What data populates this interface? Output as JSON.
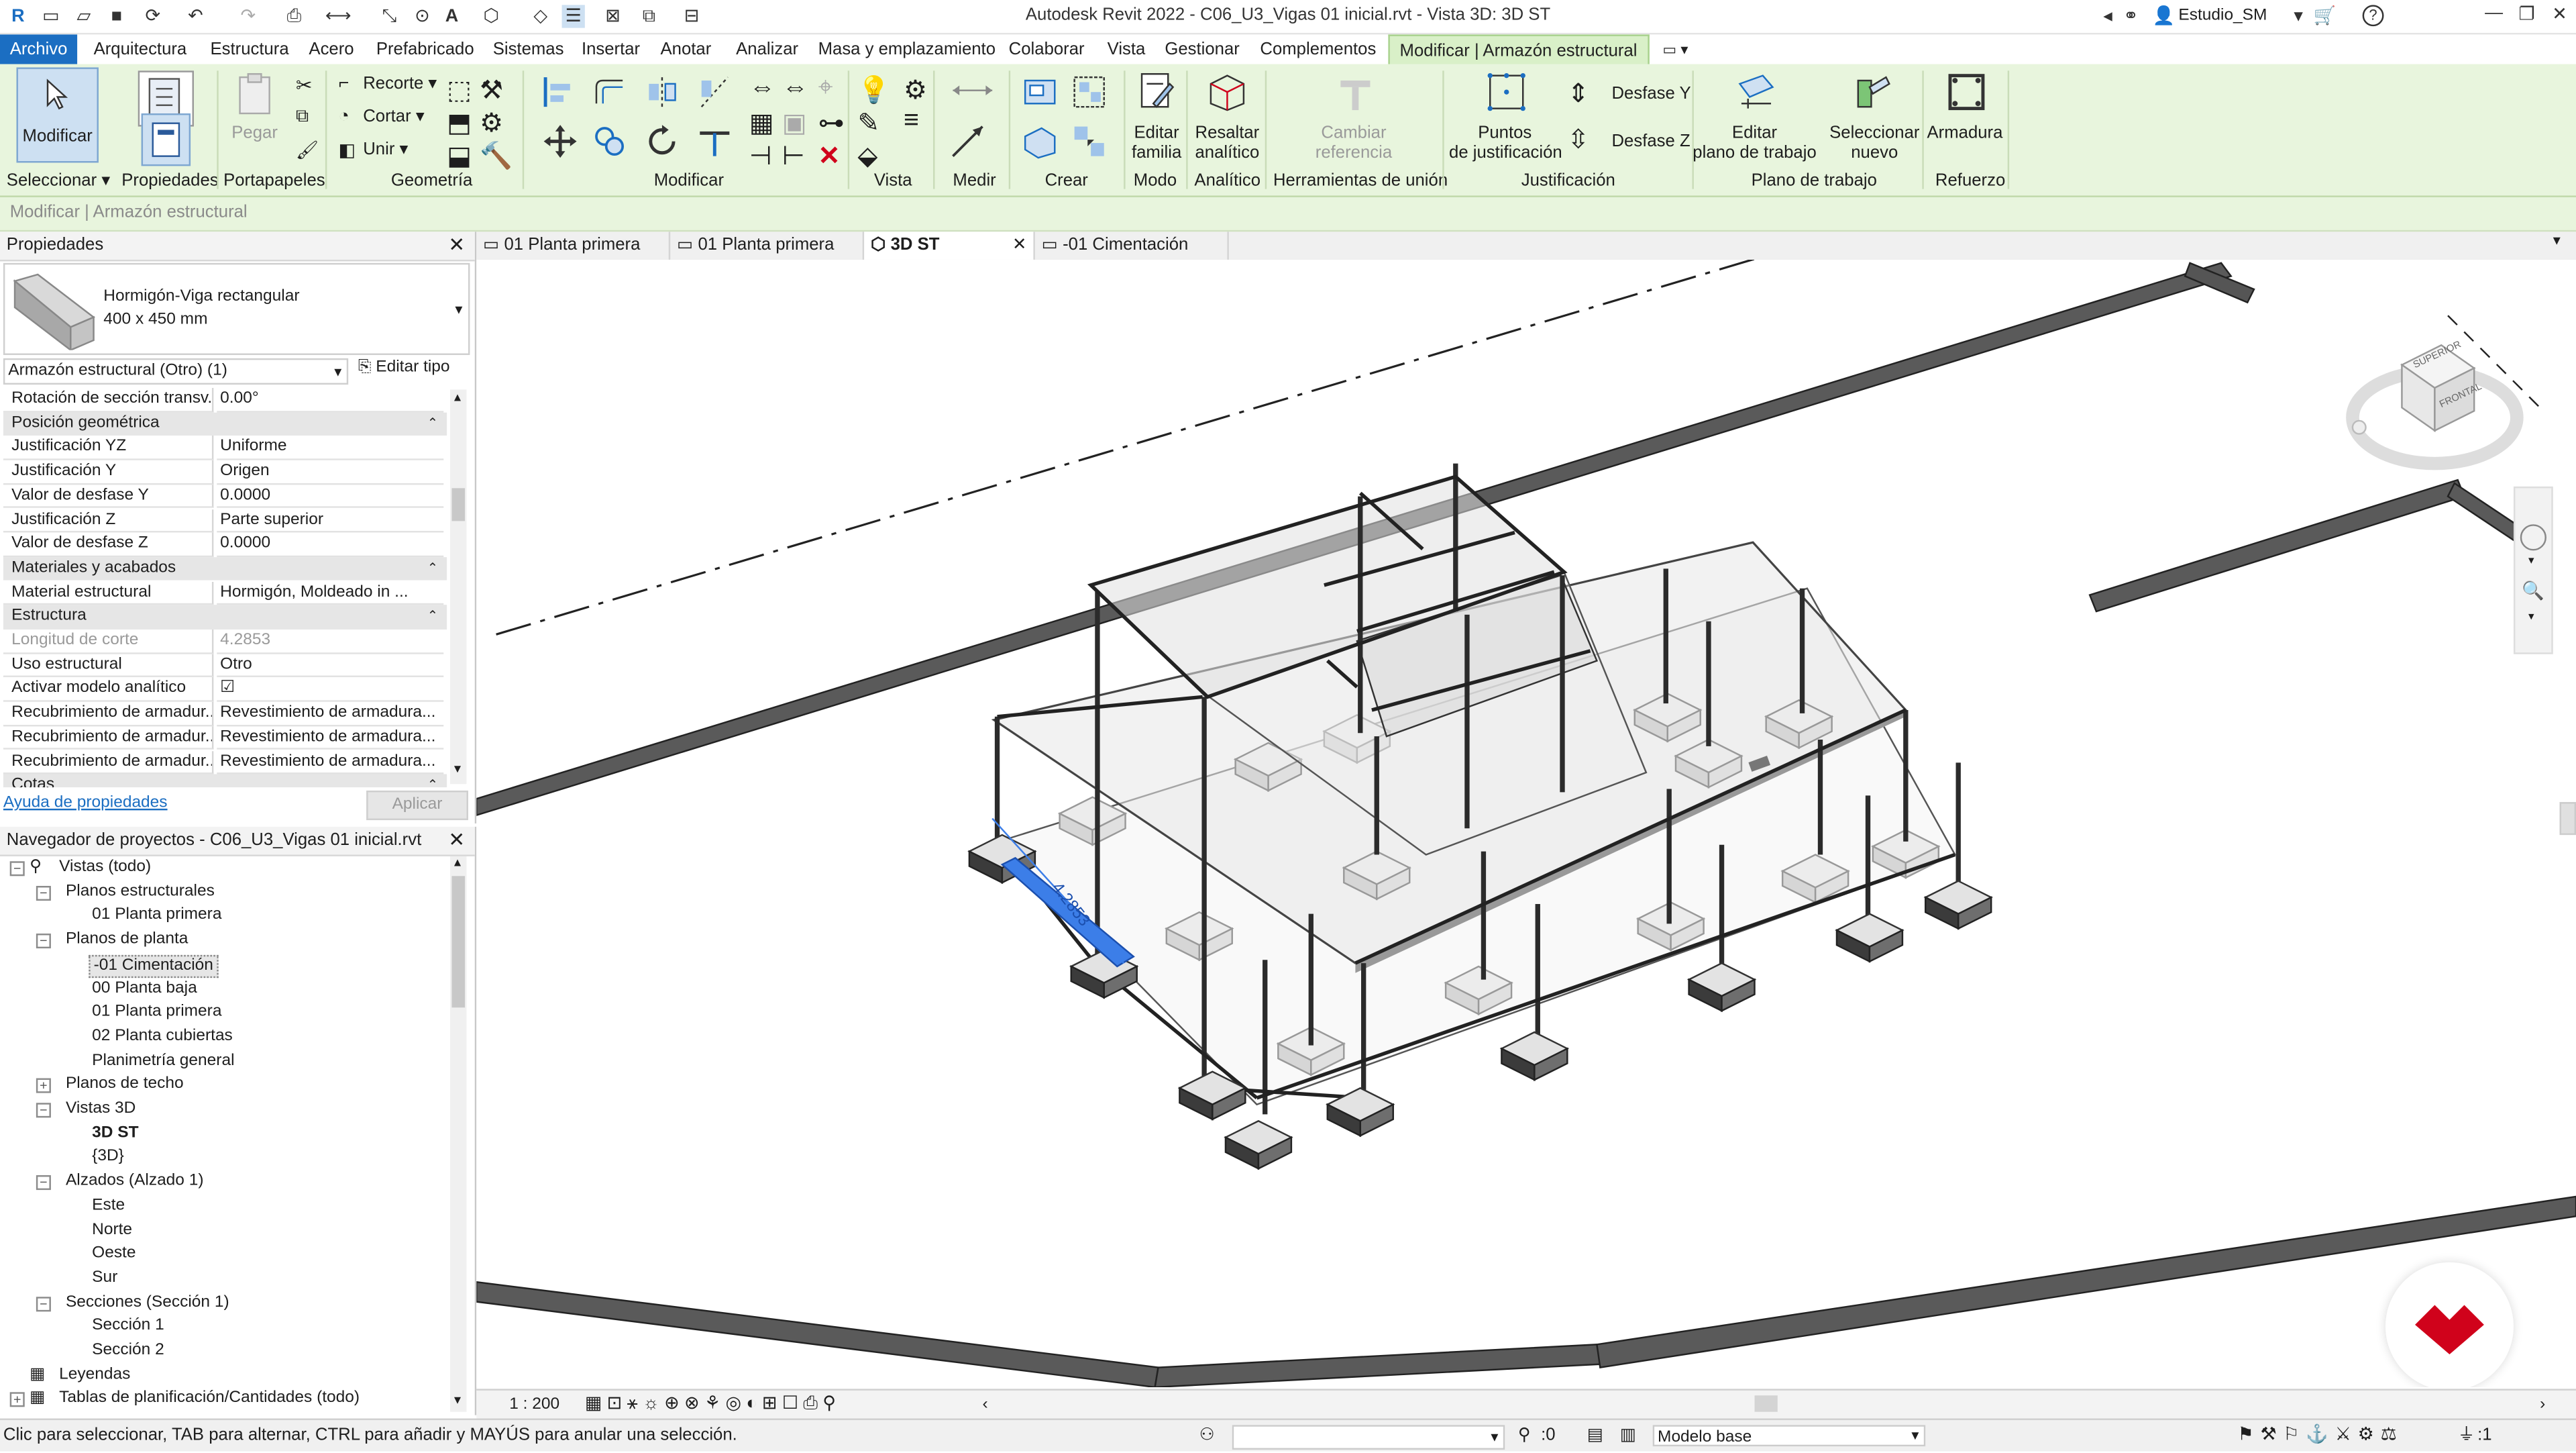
{
  "window": {
    "title": "Autodesk Revit 2022 - C06_U3_Vigas 01 inicial.rvt - Vista 3D: 3D ST",
    "user": "Estudio_SM",
    "help": "?"
  },
  "menu_tabs": [
    "Archivo",
    "Arquitectura",
    "Estructura",
    "Acero",
    "Prefabricado",
    "Sistemas",
    "Insertar",
    "Anotar",
    "Analizar",
    "Masa y emplazamiento",
    "Colaborar",
    "Vista",
    "Gestionar",
    "Complementos",
    "Modificar | Armazón estructural"
  ],
  "ribbon": {
    "modify_label": "Modificar",
    "paste_label": "Pegar",
    "recorte": "Recorte",
    "cortar": "Cortar",
    "unir": "Unir",
    "editar_familia": [
      "Editar",
      "familia"
    ],
    "resaltar_analitico": [
      "Resaltar",
      "analítico"
    ],
    "cambiar_referencia": [
      "Cambiar",
      "referencia"
    ],
    "puntos_justificacion": [
      "Puntos",
      "de justificación"
    ],
    "desfase_y": "Desfase Y",
    "desfase_z": "Desfase Z",
    "editar_plano": [
      "Editar",
      "plano de trabajo"
    ],
    "seleccionar_nuevo": [
      "Seleccionar",
      "nuevo"
    ],
    "armadura": "Armadura",
    "panels": [
      "Seleccionar",
      "Propiedades",
      "Portapapeles",
      "Geometría",
      "Modificar",
      "Vista",
      "Medir",
      "Crear",
      "Modo",
      "Analítico",
      "Herramientas de unión",
      "Justificación",
      "Plano de trabajo",
      "Refuerzo"
    ]
  },
  "options_bar": "Modificar | Armazón estructural",
  "properties": {
    "header": "Propiedades",
    "type_name": "Hormigón-Viga rectangular",
    "type_size": "400 x 450 mm",
    "filter": "Armazón estructural (Otro) (1)",
    "edit_type": "Editar tipo",
    "rows": [
      {
        "k": "Rotación de sección transv...",
        "v": "0.00°"
      },
      {
        "group": "Posición geométrica"
      },
      {
        "k": "Justificación YZ",
        "v": "Uniforme"
      },
      {
        "k": "Justificación Y",
        "v": "Origen"
      },
      {
        "k": "Valor de desfase Y",
        "v": "0.0000"
      },
      {
        "k": "Justificación Z",
        "v": "Parte superior"
      },
      {
        "k": "Valor de desfase Z",
        "v": "0.0000"
      },
      {
        "group": "Materiales y acabados"
      },
      {
        "k": "Material estructural",
        "v": "Hormigón, Moldeado in ..."
      },
      {
        "group": "Estructura"
      },
      {
        "k": "Longitud de corte",
        "v": "4.2853",
        "gray": true
      },
      {
        "k": "Uso estructural",
        "v": "Otro"
      },
      {
        "k": "Activar modelo analítico",
        "v": "☑"
      },
      {
        "k": "Recubrimiento de armadur...",
        "v": "Revestimiento de armadura..."
      },
      {
        "k": "Recubrimiento de armadur...",
        "v": "Revestimiento de armadura..."
      },
      {
        "k": "Recubrimiento de armadur...",
        "v": "Revestimiento de armadura..."
      },
      {
        "group": "Cotas"
      }
    ],
    "help_link": "Ayuda de propiedades",
    "apply": "Aplicar"
  },
  "browser": {
    "header": "Navegador de proyectos - C06_U3_Vigas 01 inicial.rvt",
    "items": [
      {
        "label": "Vistas (todo)",
        "level": 0,
        "tog": "−"
      },
      {
        "label": "Planos estructurales",
        "level": 1,
        "tog": "−"
      },
      {
        "label": "01 Planta primera",
        "level": 2
      },
      {
        "label": "Planos de planta",
        "level": 1,
        "tog": "−"
      },
      {
        "label": "-01 Cimentación",
        "level": 2,
        "selected": true
      },
      {
        "label": "00 Planta baja",
        "level": 2
      },
      {
        "label": "01 Planta primera",
        "level": 2
      },
      {
        "label": "02 Planta cubiertas",
        "level": 2
      },
      {
        "label": "Planimetría general",
        "level": 2
      },
      {
        "label": "Planos de techo",
        "level": 1,
        "tog": "+"
      },
      {
        "label": "Vistas 3D",
        "level": 1,
        "tog": "−"
      },
      {
        "label": "3D ST",
        "level": 2,
        "bold": true
      },
      {
        "label": "{3D}",
        "level": 2
      },
      {
        "label": "Alzados (Alzado 1)",
        "level": 1,
        "tog": "−"
      },
      {
        "label": "Este",
        "level": 2
      },
      {
        "label": "Norte",
        "level": 2
      },
      {
        "label": "Oeste",
        "level": 2
      },
      {
        "label": "Sur",
        "level": 2
      },
      {
        "label": "Secciones (Sección 1)",
        "level": 1,
        "tog": "−"
      },
      {
        "label": "Sección 1",
        "level": 2
      },
      {
        "label": "Sección 2",
        "level": 2
      },
      {
        "label": "Leyendas",
        "level": 0
      },
      {
        "label": "Tablas de planificación/Cantidades (todo)",
        "level": 0,
        "tog": "+"
      }
    ]
  },
  "view_tabs": [
    {
      "label": "01 Planta primera"
    },
    {
      "label": "01 Planta primera"
    },
    {
      "label": "3D ST",
      "active": true
    },
    {
      "label": "-01 Cimentación"
    }
  ],
  "viewport": {
    "temp_dimension": "4.2853",
    "viewcube_top": "SUPERIOR",
    "viewcube_front": "FRONTAL"
  },
  "view_control": {
    "scale": "1 : 200"
  },
  "status": {
    "message": "Clic para seleccionar, TAB para alternar, CTRL para añadir y MAYÚS para anular una selección.",
    "counter": ":0",
    "model": "Modelo base",
    "filter_count": ":1"
  },
  "colors": {
    "accent": "#1b6ec2",
    "ribbon": "#e8f5dd",
    "selection": "#3c7ee8",
    "logo": "#d0021b"
  }
}
